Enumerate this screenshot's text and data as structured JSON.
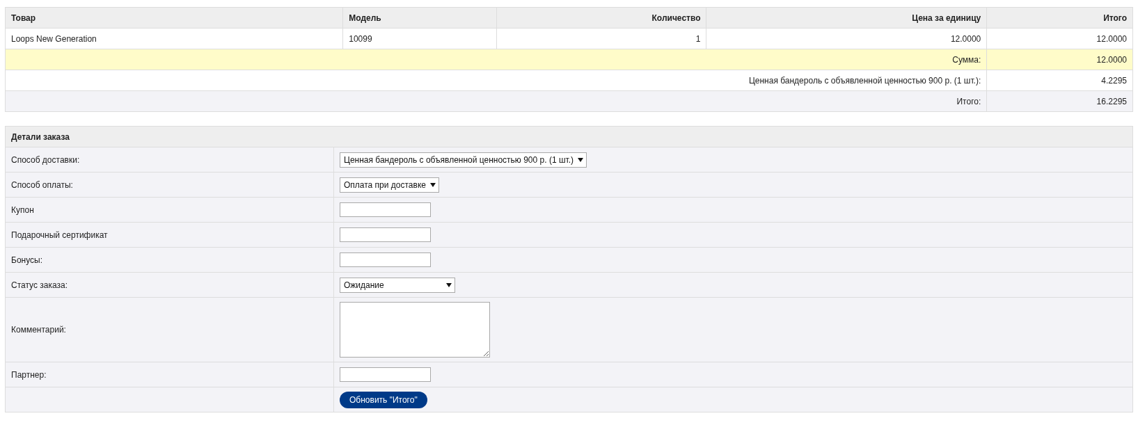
{
  "cart": {
    "columns": [
      "Товар",
      "Модель",
      "Количество",
      "Цена за единицу",
      "Итого"
    ],
    "rows": [
      {
        "cells": [
          "Loops New Generation",
          "10099",
          "1",
          "12.0000",
          "12.0000"
        ]
      }
    ],
    "totals": [
      {
        "label": "Сумма:",
        "value": "12.0000",
        "highlighted": true
      },
      {
        "label": "Ценная бандероль с объявленной ценностью 900 р. (1 шт.):",
        "value": "4.2295",
        "highlighted": false
      },
      {
        "label": "Итого:",
        "value": "16.2295",
        "highlighted": false
      }
    ]
  },
  "order_details": {
    "title": "Детали заказа",
    "fields": [
      {
        "kind": "select",
        "label": "Способ доставки:",
        "value": "Ценная бандероль с объявленной ценностью 900 р. (1 шт.)"
      },
      {
        "kind": "select",
        "label": "Способ оплаты:",
        "value": "Оплата при доставке"
      },
      {
        "kind": "input",
        "label": "Купон"
      },
      {
        "kind": "input",
        "label": "Подарочный сертификат"
      },
      {
        "kind": "input",
        "label": "Бонусы:"
      },
      {
        "kind": "select",
        "label": "Статус заказа:",
        "value": "Ожидание",
        "wide": true
      },
      {
        "kind": "textarea",
        "label": "Комментарий:"
      },
      {
        "kind": "input",
        "label": "Партнер:"
      },
      {
        "kind": "button",
        "text": "Обновить \"Итого\""
      }
    ]
  }
}
